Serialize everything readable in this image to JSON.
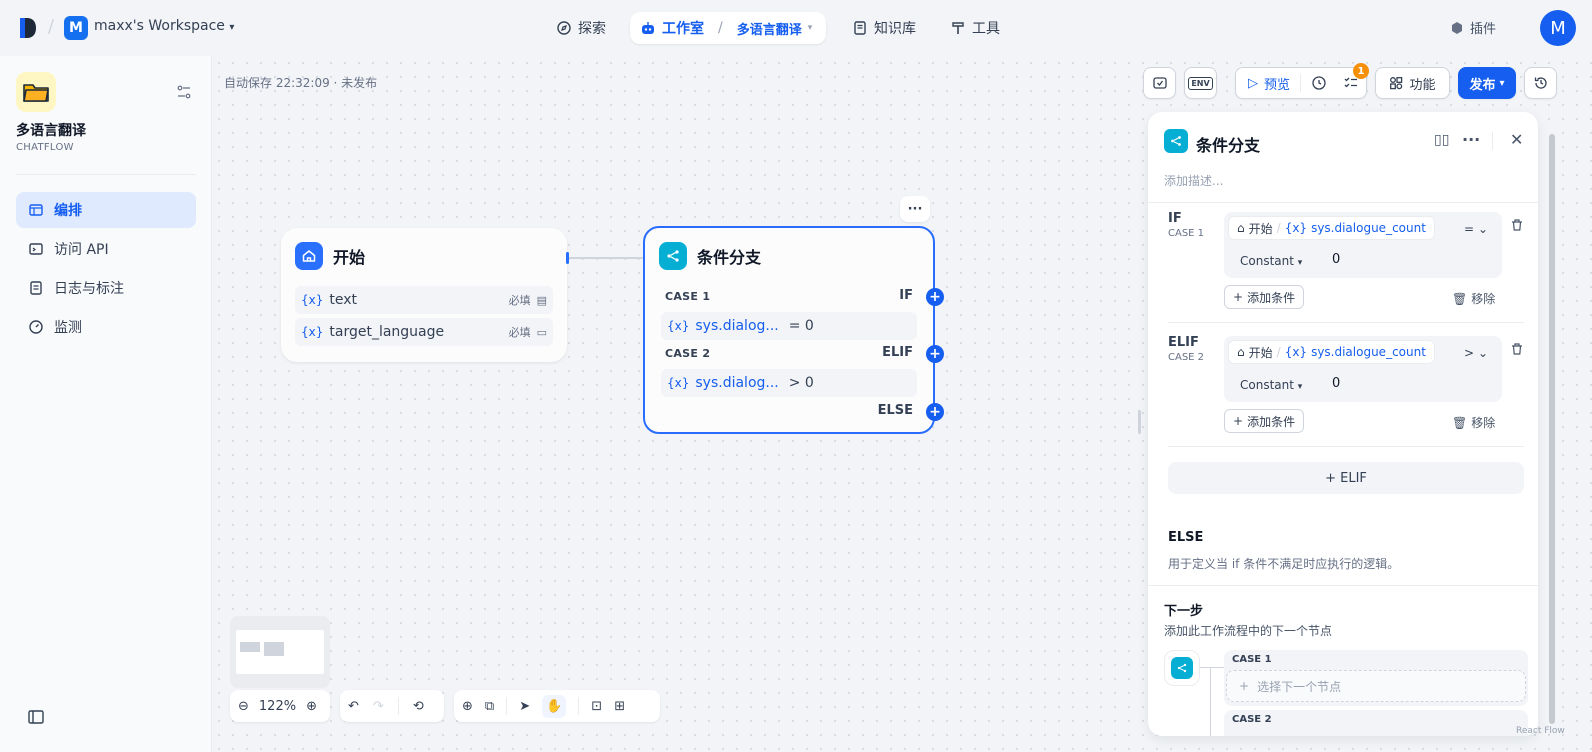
{
  "topbar": {
    "workspace_badge": "M",
    "workspace_name": "maxx's Workspace",
    "nav_explore": "探索",
    "nav_studio": "工作室",
    "nav_app": "多语言翻译",
    "nav_knowledge": "知识库",
    "nav_tools": "工具",
    "plugin": "插件",
    "avatar": "M"
  },
  "sidebar": {
    "app_name": "多语言翻译",
    "app_type": "CHATFLOW",
    "items": [
      {
        "label": "编排",
        "icon": "layout-icon",
        "active": true
      },
      {
        "label": "访问 API",
        "icon": "terminal-icon",
        "active": false
      },
      {
        "label": "日志与标注",
        "icon": "file-text-icon",
        "active": false
      },
      {
        "label": "监测",
        "icon": "gauge-icon",
        "active": false
      }
    ]
  },
  "toolbar": {
    "autosave": "自动保存 22:32:09 · 未发布",
    "env": "ENV",
    "preview": "预览",
    "checklist_badge": "1",
    "features": "功能",
    "publish": "发布"
  },
  "start_node": {
    "title": "开始",
    "vars": [
      {
        "name": "text",
        "required": "必填"
      },
      {
        "name": "target_language",
        "required": "必填"
      }
    ],
    "var_prefix": "{x}"
  },
  "if_node": {
    "title": "条件分支",
    "case1_label": "CASE 1",
    "case1_kw": "IF",
    "case1_var": "sys.dialog...",
    "case1_cond": "= 0",
    "case2_label": "CASE 2",
    "case2_kw": "ELIF",
    "case2_var": "sys.dialog...",
    "case2_cond": "> 0",
    "else_kw": "ELSE"
  },
  "zoom": {
    "level": "122%"
  },
  "panel": {
    "title": "条件分支",
    "description_placeholder": "添加描述...",
    "if_label": "IF",
    "if_case": "CASE 1",
    "elif_label": "ELIF",
    "elif_case": "CASE 2",
    "source_node": "开始",
    "var_name": "sys.dialogue_count",
    "op1": "=",
    "op2": ">",
    "constant": "Constant",
    "value1": "0",
    "value2": "0",
    "add_condition": "添加条件",
    "remove": "移除",
    "add_elif": "+ ELIF",
    "else_title": "ELSE",
    "else_desc": "用于定义当 if 条件不满足时应执行的逻辑。",
    "next_title": "下一步",
    "next_desc": "添加此工作流程中的下一个节点",
    "next_case1": "CASE 1",
    "next_case2": "CASE 2",
    "select_next": "选择下一个节点"
  },
  "attribution": "React Flow",
  "colors": {
    "accent": "#155eef",
    "if_node_icon": "#06aed4",
    "start_node_icon": "#2970ff",
    "badge": "#f79009"
  }
}
